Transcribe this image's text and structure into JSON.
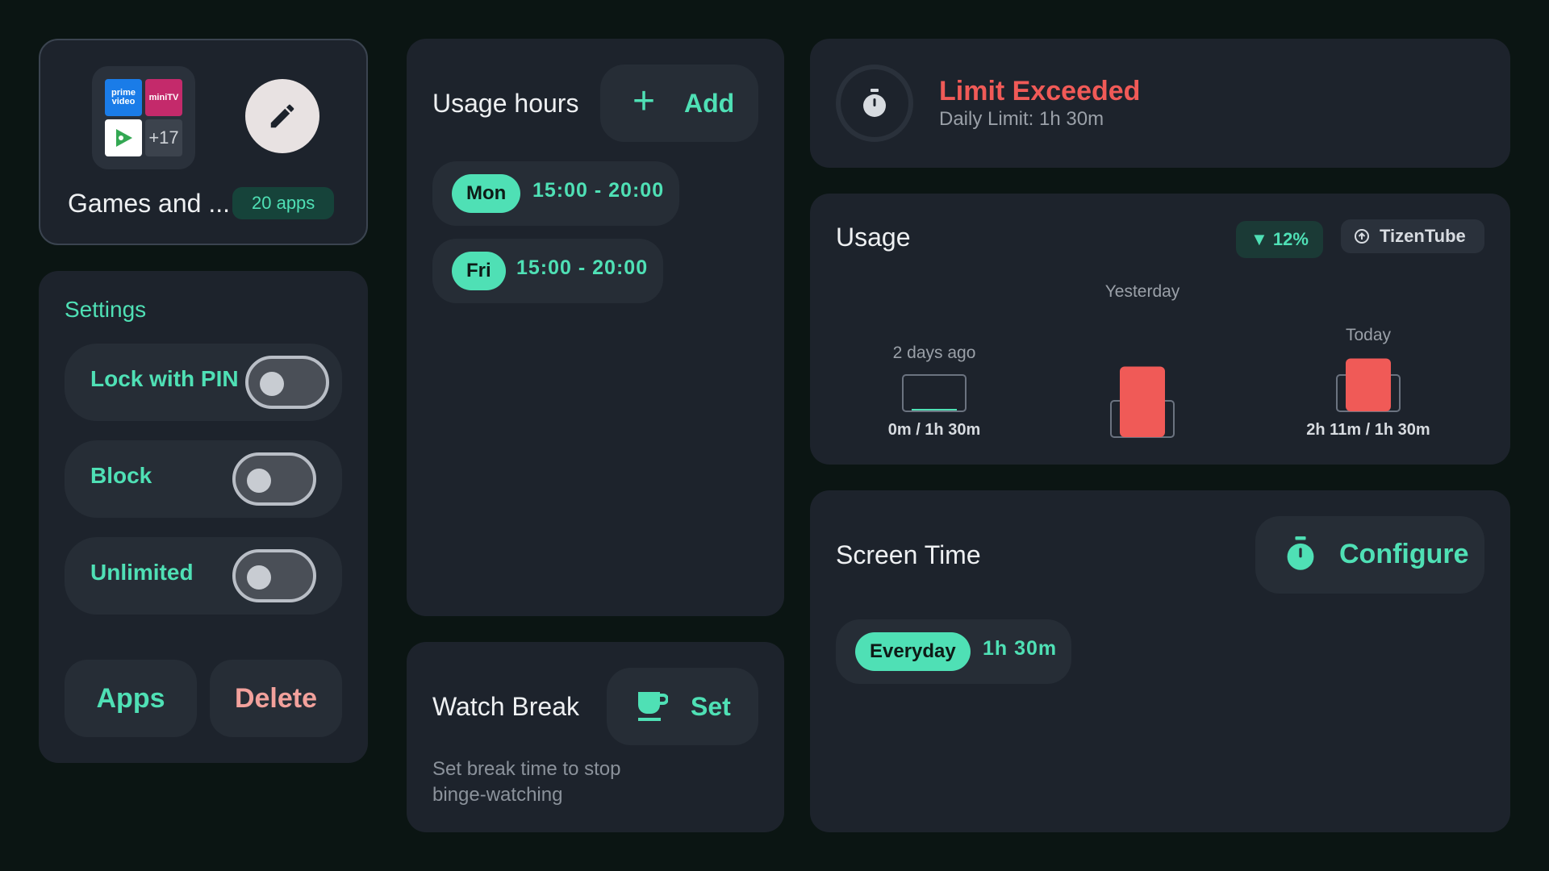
{
  "group": {
    "name": "Games and ...",
    "apps_count": "20 apps",
    "app_icons": [
      "prime-video-icon",
      "minitv-icon",
      "play-games-icon"
    ],
    "prime_label": "prime video",
    "minitv_label": "miniTV",
    "more_count": "+17"
  },
  "settings": {
    "title": "Settings",
    "items": [
      {
        "label": "Lock with PIN",
        "enabled": false
      },
      {
        "label": "Block",
        "enabled": false
      },
      {
        "label": "Unlimited",
        "enabled": false
      }
    ],
    "apps_label": "Apps",
    "delete_label": "Delete"
  },
  "usage_hours": {
    "title": "Usage hours",
    "add_label": "Add",
    "schedules": [
      {
        "day": "Mon",
        "time": "15:00 - 20:00"
      },
      {
        "day": "Fri",
        "time": "15:00 - 20:00"
      }
    ]
  },
  "watch_break": {
    "title": "Watch Break",
    "set_label": "Set",
    "description": "Set break time to stop binge-watching"
  },
  "limit": {
    "title": "Limit Exceeded",
    "subtitle": "Daily Limit: 1h 30m"
  },
  "usage": {
    "title": "Usage",
    "trend": "▼ 12%",
    "app_name": "TizenTube",
    "colors": {
      "bar": "#f05a57",
      "accent": "#4fe0b5",
      "limit_outline": "#6b7380"
    }
  },
  "chart_data": {
    "type": "bar",
    "categories": [
      "2 days ago",
      "Yesterday",
      "Today"
    ],
    "values_minutes": [
      0,
      175,
      131
    ],
    "limit_minutes": 90,
    "value_labels": [
      "0m / 1h 30m",
      "",
      "2h 11m / 1h 30m"
    ]
  },
  "screen_time": {
    "title": "Screen Time",
    "configure_label": "Configure",
    "rows": [
      {
        "day": "Everyday",
        "duration": "1h 30m"
      }
    ]
  },
  "theme": {
    "accent": "#4fe0b5",
    "danger": "#f05a57",
    "card": "#1d232c",
    "background": "#0b1513"
  }
}
